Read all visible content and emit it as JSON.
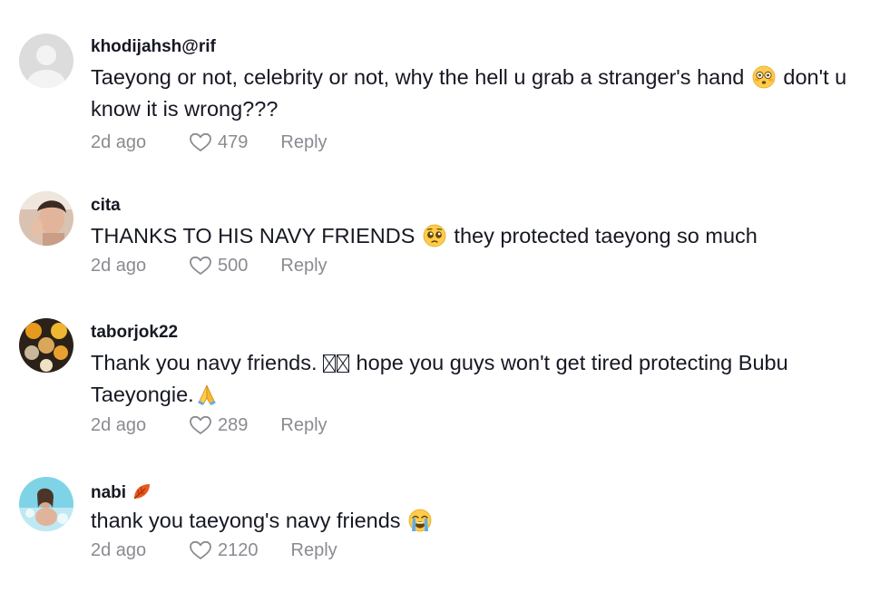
{
  "comments": [
    {
      "username": "khodijahsh@rif",
      "text_parts": [
        "Taeyong or not, celebrity or not, why the hell u grab a stranger's hand",
        " don't u know it is wrong???"
      ],
      "emoji": "flushed-face-emoji",
      "time": "2d ago",
      "likes": "479",
      "reply": "Reply",
      "avatar": "default-avatar"
    },
    {
      "username": "cita",
      "text_parts": [
        "THANKS TO HIS NAVY FRIENDS",
        " they protected taeyong so much"
      ],
      "emoji": "pleading-face-emoji",
      "time": "2d ago",
      "likes": "500",
      "reply": "Reply",
      "avatar": "photo-avatar"
    },
    {
      "username": "taborjok22",
      "text_parts": [
        "Thank you navy friends.",
        " hope you guys won't get tired protecting Bubu Taeyongie."
      ],
      "emoji": "folded-hands-emoji",
      "time": "2d ago",
      "likes": "289",
      "reply": "Reply",
      "avatar": "food-photo-avatar"
    },
    {
      "username": "nabi",
      "username_emoji": "fallen-leaf-emoji",
      "text_parts": [
        "thank you taeyong's navy friends",
        ""
      ],
      "emoji": "loudly-crying-face-emoji",
      "time": "2d ago",
      "likes": "2120",
      "reply": "Reply",
      "avatar": "photo-avatar"
    }
  ],
  "colors": {
    "text": "#161823",
    "meta": "#8a8b91",
    "default_avatar_bg": "#d9d9d9"
  }
}
